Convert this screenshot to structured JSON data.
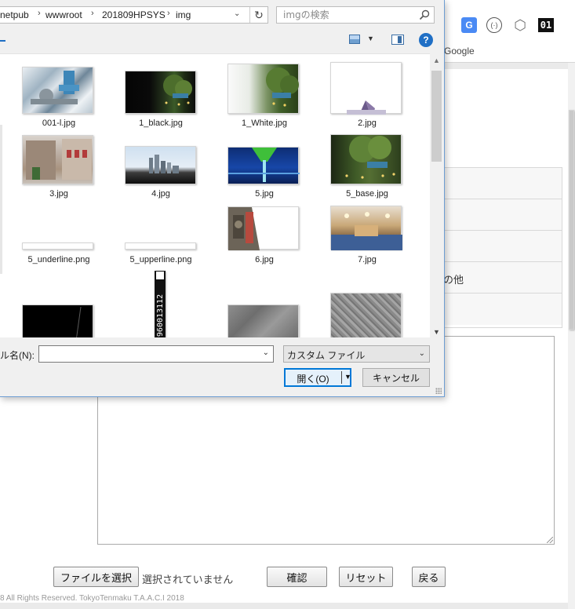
{
  "browser": {
    "extensions": [
      {
        "name": "translate-icon",
        "label": "G"
      },
      {
        "name": "reader-icon",
        "label": "(·)"
      },
      {
        "name": "package-icon",
        "label": "⬡"
      },
      {
        "name": "counter-icon",
        "label": "01"
      }
    ],
    "bookmark": "Google"
  },
  "dialog": {
    "breadcrumb": [
      "netpub",
      "wwwroot",
      "201809HPSYS",
      "img"
    ],
    "search_placeholder": "imgの検索",
    "help_label": "?",
    "files": [
      {
        "name": "001-l.jpg"
      },
      {
        "name": "1_black.jpg"
      },
      {
        "name": "1_White.jpg"
      },
      {
        "name": "2.jpg"
      },
      {
        "name": "3.jpg"
      },
      {
        "name": "4.jpg"
      },
      {
        "name": "5.jpg"
      },
      {
        "name": "5_base.jpg"
      },
      {
        "name": "5_underline.png"
      },
      {
        "name": "5_upperline.png"
      },
      {
        "name": "6.jpg"
      },
      {
        "name": "7.jpg"
      },
      {
        "name": "",
        "thumb_text": "960013112"
      }
    ],
    "filename_label": "ル名(N):",
    "filename_value": "",
    "filetype_value": "カスタム ファイル",
    "open_label": "開く(O)",
    "cancel_label": "キャンセル"
  },
  "page": {
    "row_label_other": "の他",
    "file_button": "ファイルを選択",
    "no_file_text": "選択されていません",
    "confirm_button": "確認",
    "reset_button": "リセット",
    "back_button": "戻る",
    "footer": "8 All Rights Reserved. TokyoTenmaku T.A.A.C.I 2018"
  }
}
